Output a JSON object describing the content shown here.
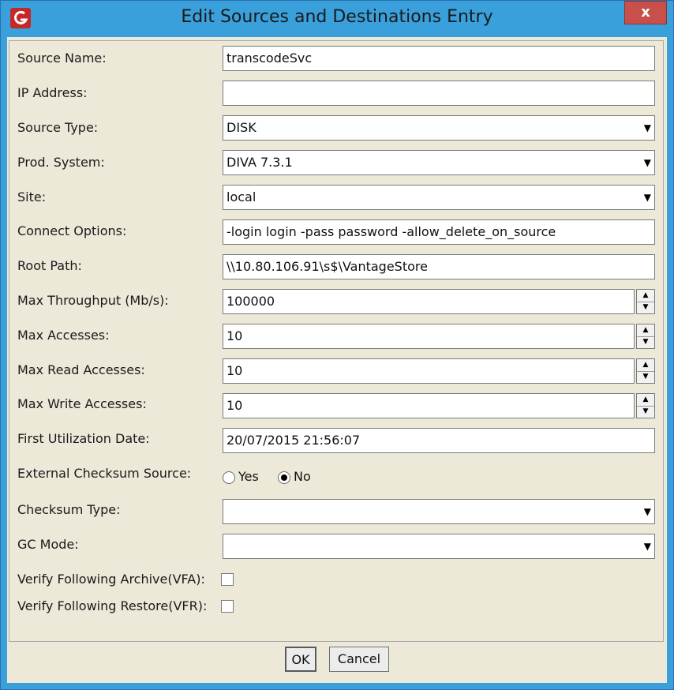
{
  "window": {
    "title": "Edit Sources and Destinations Entry",
    "close_label": "x",
    "titlebar_color": "#39a0dc",
    "app_icon": "app-logo-icon"
  },
  "form": {
    "source_name": {
      "label": "Source Name:",
      "value": "transcodeSvc"
    },
    "ip_address": {
      "label": "IP Address:",
      "value": ""
    },
    "source_type": {
      "label": "Source Type:",
      "value": "DISK"
    },
    "prod_system": {
      "label": "Prod. System:",
      "value": "DIVA 7.3.1"
    },
    "site": {
      "label": "Site:",
      "value": "local"
    },
    "connect_options": {
      "label": "Connect Options:",
      "value": "-login login -pass password -allow_delete_on_source"
    },
    "root_path": {
      "label": "Root Path:",
      "value": "\\\\10.80.106.91\\s$\\VantageStore"
    },
    "max_throughput": {
      "label": "Max Throughput (Mb/s):",
      "value": "100000"
    },
    "max_accesses": {
      "label": "Max Accesses:",
      "value": "10"
    },
    "max_read_accesses": {
      "label": "Max Read Accesses:",
      "value": "10"
    },
    "max_write_accesses": {
      "label": "Max Write Accesses:",
      "value": "10"
    },
    "first_utilization_date": {
      "label": "First Utilization Date:",
      "value": "20/07/2015 21:56:07"
    },
    "external_checksum_source": {
      "label": "External Checksum Source:",
      "yes_label": "Yes",
      "no_label": "No",
      "selected": "No"
    },
    "checksum_type": {
      "label": "Checksum Type:",
      "value": ""
    },
    "gc_mode": {
      "label": "GC Mode:",
      "value": ""
    },
    "vfa": {
      "label": "Verify Following Archive(VFA):",
      "checked": false
    },
    "vfr": {
      "label": "Verify Following Restore(VFR):",
      "checked": false
    }
  },
  "buttons": {
    "ok": "OK",
    "cancel": "Cancel"
  }
}
